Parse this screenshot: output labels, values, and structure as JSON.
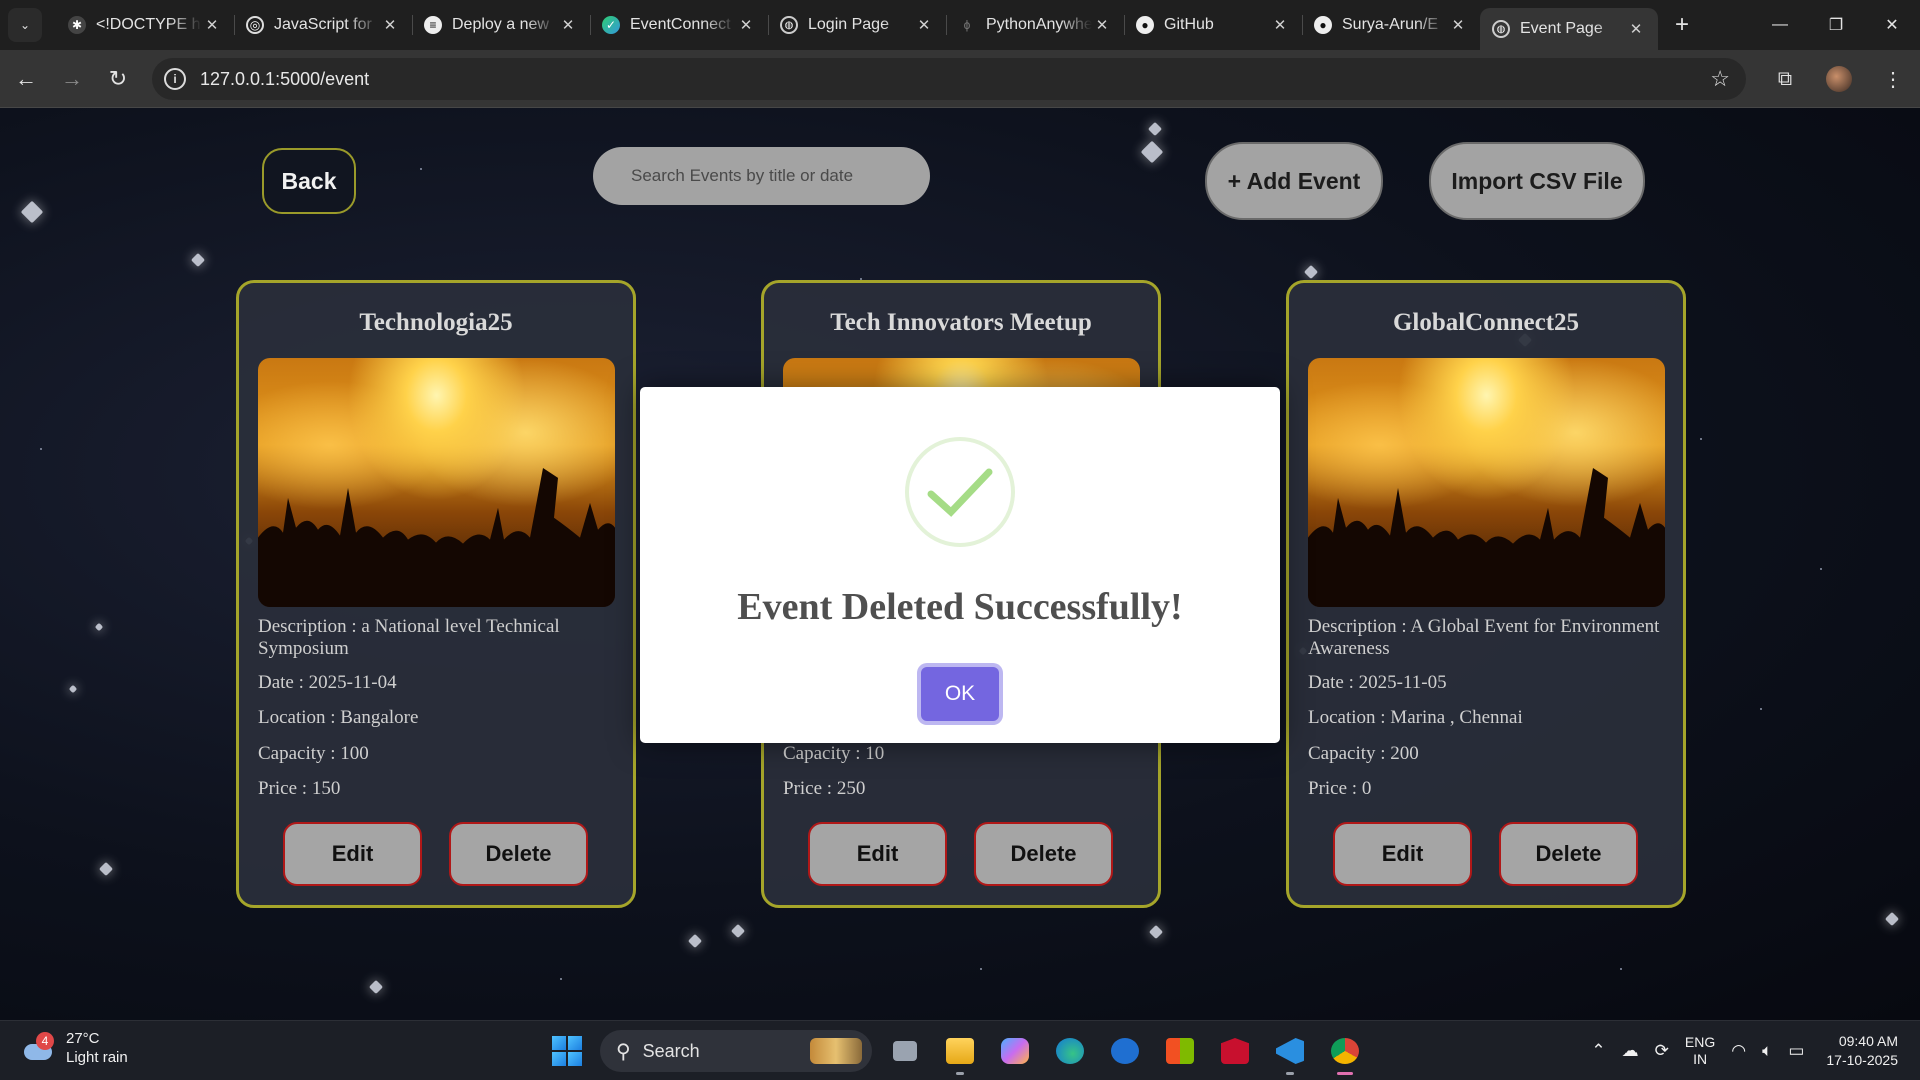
{
  "browser": {
    "tabs": [
      {
        "title": "<!DOCTYPE html>",
        "icon": "generic-app-icon"
      },
      {
        "title": "JavaScript for",
        "icon": "openai-icon"
      },
      {
        "title": "Deploy a new",
        "icon": "deploy-icon"
      },
      {
        "title": "EventConnect",
        "icon": "eventconnect-icon"
      },
      {
        "title": "Login Page",
        "icon": "globe-icon"
      },
      {
        "title": "PythonAnywhere",
        "icon": "python-icon"
      },
      {
        "title": "GitHub",
        "icon": "github-icon"
      },
      {
        "title": "Surya-Arun/E",
        "icon": "github-icon"
      },
      {
        "title": "Event Page",
        "icon": "globe-icon",
        "active": true
      }
    ],
    "url": "127.0.0.1:5000/event"
  },
  "page": {
    "back_label": "Back",
    "search_placeholder": "Search Events by title or date",
    "add_event_label": "+ Add Event",
    "import_csv_label": "Import CSV File",
    "edit_label": "Edit",
    "delete_label": "Delete",
    "events": [
      {
        "title": "Technologia25",
        "description": "Description : a National level Technical Symposium",
        "date": "Date : 2025-11-04",
        "location": "Location : Bangalore",
        "capacity": "Capacity : 100",
        "price": "Price : 150"
      },
      {
        "title": "Tech Innovators Meetup",
        "description": "",
        "date": "",
        "location": "",
        "capacity": "Capacity : 10",
        "price": "Price : 250"
      },
      {
        "title": "GlobalConnect25",
        "description": "Description : A Global Event for Environment Awareness",
        "date": "Date : 2025-11-05",
        "location": "Location : Marina , Chennai",
        "capacity": "Capacity : 200",
        "price": "Price : 0"
      }
    ]
  },
  "modal": {
    "title": "Event Deleted Successfully!",
    "ok_label": "OK",
    "icon": "check-icon",
    "accent": "#7466e0"
  },
  "taskbar": {
    "weather_temp": "27°C",
    "weather_desc": "Light rain",
    "weather_badge": "4",
    "search_label": "Search",
    "lang_top": "ENG",
    "lang_bottom": "IN",
    "time": "09:40 AM",
    "date": "17-10-2025"
  }
}
